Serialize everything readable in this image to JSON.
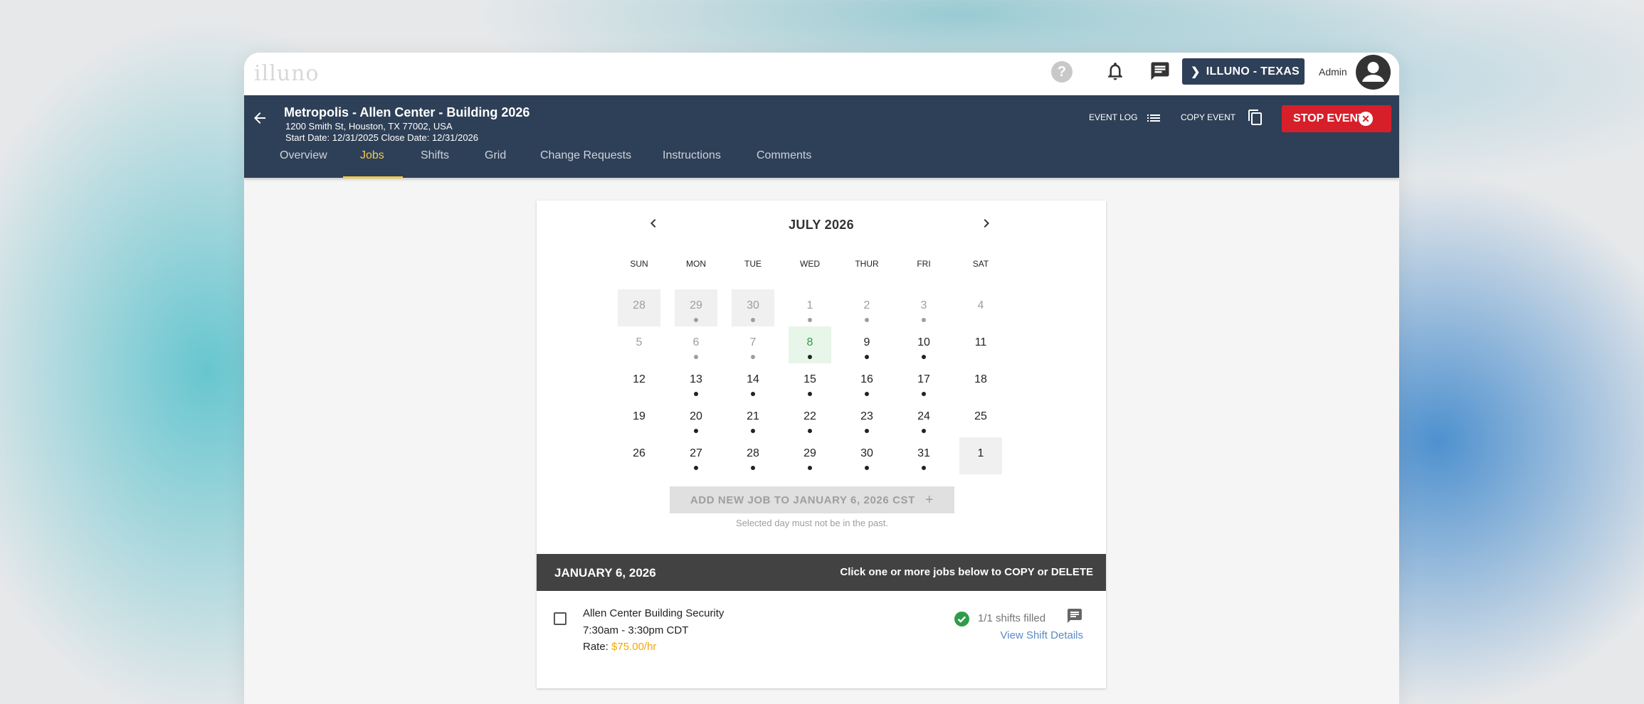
{
  "app": {
    "logo_text": "illuno",
    "org_button": "ILLUNO - TEXAS",
    "user_label": "Admin",
    "icons": [
      "help-icon",
      "bell-icon",
      "chat-icon",
      "avatar-icon"
    ]
  },
  "event": {
    "title": "Metropolis - Allen Center - Building 2026",
    "address": "1200 Smith St, Houston, TX 77002, USA",
    "dates": "Start Date: 12/31/2025 Close Date: 12/31/2026",
    "event_log_label": "EVENT LOG",
    "copy_event_label": "COPY EVENT",
    "stop_event_label": "STOP EVENT"
  },
  "tabs": [
    {
      "label": "Overview",
      "active": false
    },
    {
      "label": "Jobs",
      "active": true
    },
    {
      "label": "Shifts",
      "active": false
    },
    {
      "label": "Grid",
      "active": false
    },
    {
      "label": "Change Requests",
      "active": false
    },
    {
      "label": "Instructions",
      "active": false
    },
    {
      "label": "Comments",
      "active": false
    }
  ],
  "calendar": {
    "month_label": "JULY 2026",
    "weekdays": [
      "SUN",
      "MON",
      "TUE",
      "WED",
      "THUR",
      "FRI",
      "SAT"
    ],
    "weeks": [
      [
        {
          "d": "28",
          "state": "past-out",
          "dot": "none"
        },
        {
          "d": "29",
          "state": "past-out",
          "dot": "grey"
        },
        {
          "d": "30",
          "state": "past-out",
          "dot": "grey"
        },
        {
          "d": "1",
          "state": "past",
          "dot": "grey"
        },
        {
          "d": "2",
          "state": "past",
          "dot": "grey"
        },
        {
          "d": "3",
          "state": "past",
          "dot": "grey"
        },
        {
          "d": "4",
          "state": "past",
          "dot": "none"
        }
      ],
      [
        {
          "d": "5",
          "state": "past",
          "dot": "none"
        },
        {
          "d": "6",
          "state": "past",
          "dot": "grey"
        },
        {
          "d": "7",
          "state": "past",
          "dot": "grey"
        },
        {
          "d": "8",
          "state": "today",
          "dot": "dark"
        },
        {
          "d": "9",
          "state": "future",
          "dot": "dark"
        },
        {
          "d": "10",
          "state": "future",
          "dot": "dark"
        },
        {
          "d": "11",
          "state": "future",
          "dot": "none"
        }
      ],
      [
        {
          "d": "12",
          "state": "future",
          "dot": "none"
        },
        {
          "d": "13",
          "state": "future",
          "dot": "dark"
        },
        {
          "d": "14",
          "state": "future",
          "dot": "dark"
        },
        {
          "d": "15",
          "state": "future",
          "dot": "dark"
        },
        {
          "d": "16",
          "state": "future",
          "dot": "dark"
        },
        {
          "d": "17",
          "state": "future",
          "dot": "dark"
        },
        {
          "d": "18",
          "state": "future",
          "dot": "none"
        }
      ],
      [
        {
          "d": "19",
          "state": "future",
          "dot": "none"
        },
        {
          "d": "20",
          "state": "future",
          "dot": "dark"
        },
        {
          "d": "21",
          "state": "future",
          "dot": "dark"
        },
        {
          "d": "22",
          "state": "future",
          "dot": "dark"
        },
        {
          "d": "23",
          "state": "future",
          "dot": "dark"
        },
        {
          "d": "24",
          "state": "future",
          "dot": "dark"
        },
        {
          "d": "25",
          "state": "future",
          "dot": "none"
        }
      ],
      [
        {
          "d": "26",
          "state": "future",
          "dot": "none"
        },
        {
          "d": "27",
          "state": "future",
          "dot": "dark"
        },
        {
          "d": "28",
          "state": "future",
          "dot": "dark"
        },
        {
          "d": "29",
          "state": "future",
          "dot": "dark"
        },
        {
          "d": "30",
          "state": "future",
          "dot": "dark"
        },
        {
          "d": "31",
          "state": "future",
          "dot": "dark"
        },
        {
          "d": "1",
          "state": "future-out",
          "dot": "none"
        }
      ]
    ],
    "add_job_label": "ADD NEW JOB TO JANUARY 6, 2026 CST",
    "add_job_hint": "Selected day must not be in the past."
  },
  "jobs_panel": {
    "selected_date": "JANUARY 6, 2026",
    "hint": "Click one or more jobs below to COPY or DELETE",
    "jobs": [
      {
        "name": "Allen Center Building Security",
        "time": "7:30am - 3:30pm CDT",
        "rate_label": "Rate: ",
        "rate_value": "$75.00/hr",
        "filled": "1/1 shifts filled",
        "details_link": "View Shift Details"
      }
    ]
  },
  "colors": {
    "navy": "#2e4057",
    "accent_yellow": "#f2c94c",
    "stop_red": "#d71f2a",
    "filled_green": "#2e9c4a",
    "link_blue": "#5a8bc4",
    "rate_gold": "#f2a900"
  }
}
